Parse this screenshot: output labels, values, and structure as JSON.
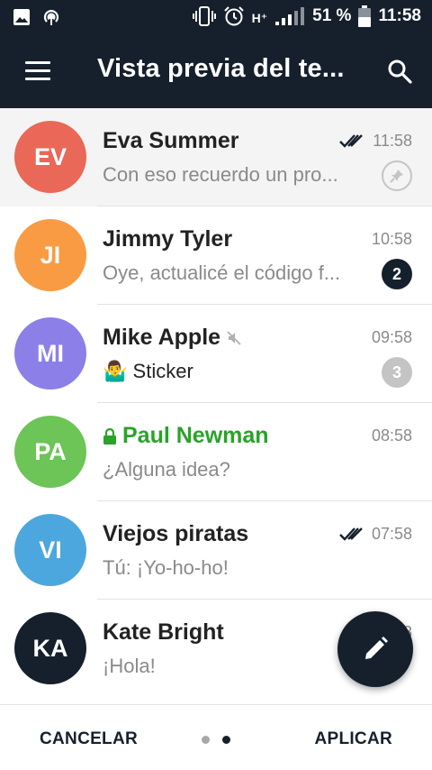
{
  "status_bar": {
    "network_type": "H⁺",
    "battery_percent": "51 %",
    "time": "11:58",
    "icons": [
      "image-icon",
      "hotspot-icon",
      "vibrate-icon",
      "alarm-icon",
      "signal-icon",
      "battery-icon"
    ]
  },
  "app_bar": {
    "title": "Vista previa del te...",
    "menu_icon": "menu-icon",
    "search_icon": "search-icon"
  },
  "colors": {
    "primary": "#16202c",
    "secret_green": "#29a329",
    "muted_gray": "#c4c4c4"
  },
  "chats": [
    {
      "initials": "EV",
      "name": "Eva Summer",
      "time": "11:58",
      "preview": "Con eso recuerdo un pro...",
      "read_ticks": true,
      "pinned": true,
      "avatar_color": "#e96857"
    },
    {
      "initials": "JI",
      "name": "Jimmy Tyler",
      "time": "10:58",
      "preview": "Oye, actualicé el código f...",
      "unread": "2",
      "avatar_color": "#f99b43"
    },
    {
      "initials": "MI",
      "name": "Mike Apple",
      "time": "09:58",
      "preview": "Sticker",
      "preview_emoji": "🤷‍♂️",
      "muted": true,
      "unread": "3",
      "avatar_color": "#8c7fe8"
    },
    {
      "initials": "PA",
      "name": "Paul Newman",
      "time": "08:58",
      "preview": "¿Alguna idea?",
      "secret": true,
      "avatar_color": "#6dc457"
    },
    {
      "initials": "VI",
      "name": "Viejos piratas",
      "time": "07:58",
      "preview": "Tú: ¡Yo-ho-ho!",
      "read_ticks": true,
      "avatar_color": "#4ca7de"
    },
    {
      "initials": "KA",
      "name": "Kate Bright",
      "time": "06:58",
      "preview": "¡Hola!",
      "avatar_color": "#16202c"
    }
  ],
  "bottom_bar": {
    "cancel_label": "CANCELAR",
    "apply_label": "APLICAR",
    "page_count": 2,
    "active_page": 2
  }
}
